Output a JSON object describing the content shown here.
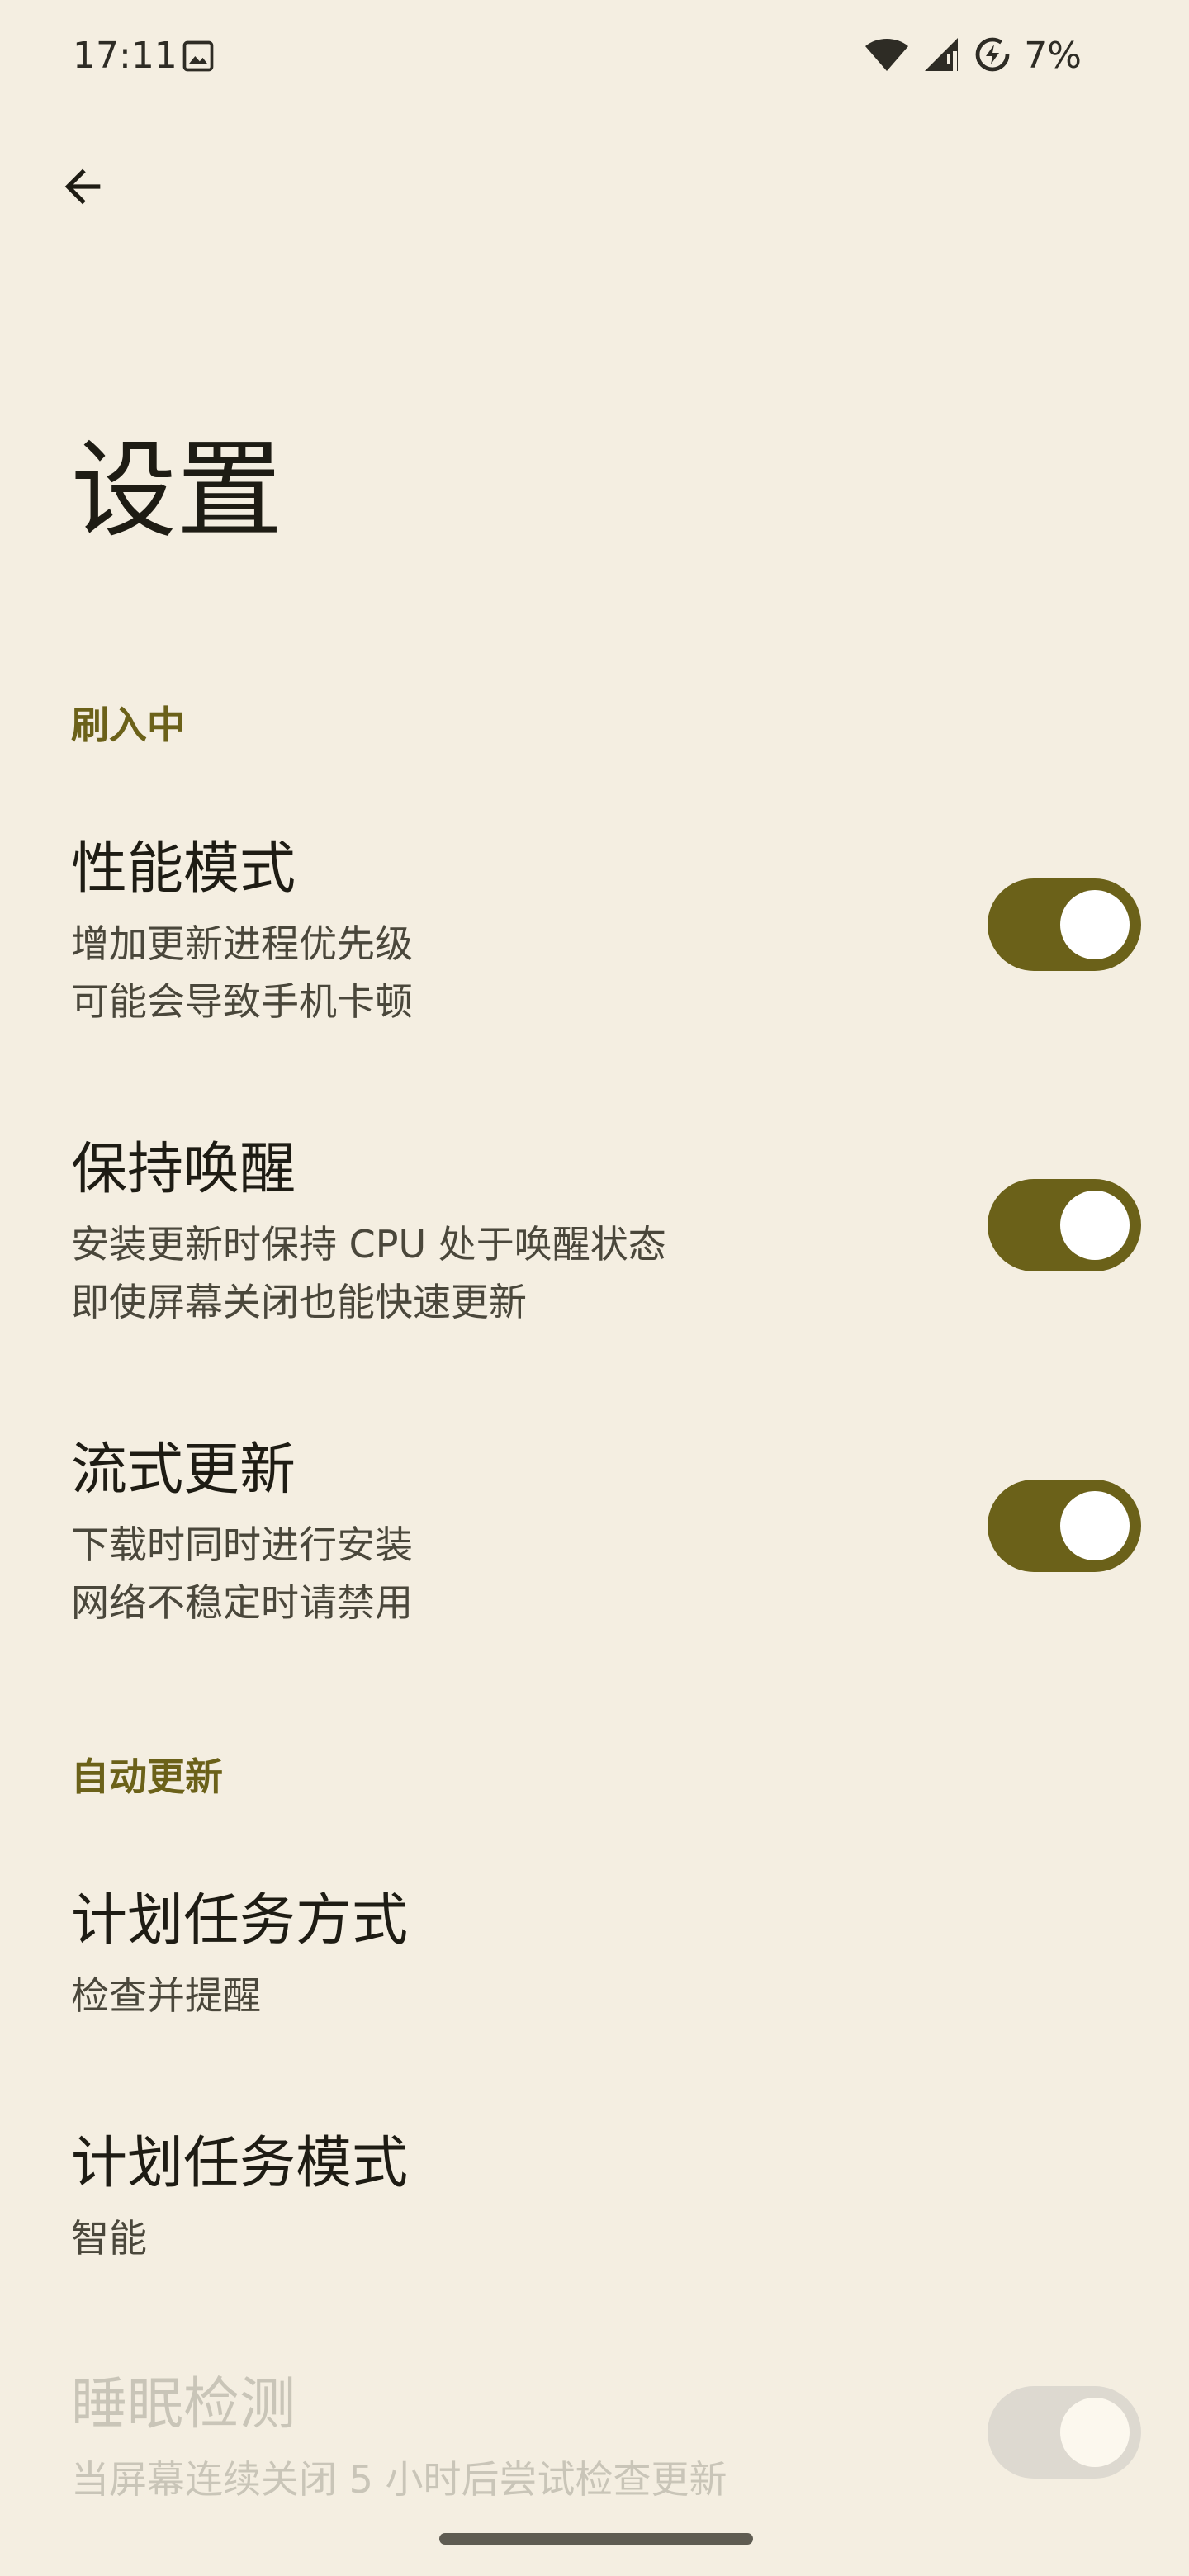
{
  "status_bar": {
    "time": "17:11",
    "battery": "7%",
    "icons": [
      "image-icon",
      "wifi-icon",
      "signal-icon",
      "battery-saver-icon"
    ]
  },
  "header": {
    "back_icon": "arrow-back-icon",
    "title": "设置"
  },
  "sections": [
    {
      "header": "刷入中",
      "items": [
        {
          "title": "性能模式",
          "summary": [
            "增加更新进程优先级",
            "可能会导致手机卡顿"
          ],
          "switch_on": true
        },
        {
          "title": "保持唤醒",
          "summary": [
            "安装更新时保持 CPU 处于唤醒状态",
            "即使屏幕关闭也能快速更新"
          ],
          "switch_on": true
        },
        {
          "title": "流式更新",
          "summary": [
            "下载时同时进行安装",
            "网络不稳定时请禁用"
          ],
          "switch_on": true
        }
      ]
    },
    {
      "header": "自动更新",
      "items": [
        {
          "title": "计划任务方式",
          "summary": [
            "检查并提醒"
          ]
        },
        {
          "title": "计划任务模式",
          "summary": [
            "智能"
          ]
        },
        {
          "title": "睡眠检测",
          "summary": [
            "当屏幕连续关闭 5 小时后尝试检查更新"
          ],
          "switch_on": true,
          "disabled": true
        }
      ]
    }
  ],
  "colors": {
    "background": "#F4EEE1",
    "accent": "#6B6119",
    "switch_disabled": "#DDD9D0"
  }
}
